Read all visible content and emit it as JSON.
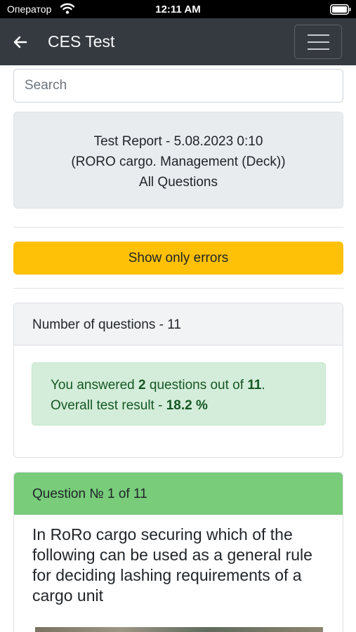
{
  "statusbar": {
    "carrier": "Оператор",
    "time": "12:11 AM"
  },
  "navbar": {
    "title": "CES Test"
  },
  "search": {
    "placeholder": "Search"
  },
  "report": {
    "line1": "Test Report - 5.08.2023 0:10",
    "line2": "(RORO cargo. Management (Deck))",
    "line3": "All Questions"
  },
  "errors_button": {
    "label": "Show only errors"
  },
  "summary": {
    "header": "Number of questions - 11",
    "answered_prefix": "You answered ",
    "answered_count": "2",
    "answered_middle": " questions out of ",
    "total": "11",
    "answered_suffix": ".",
    "result_prefix": "Overall test result - ",
    "result_value": "18.2 %"
  },
  "question": {
    "header": "Question № 1 of 11",
    "text": "In RoRo cargo securing which of the following can be used as a general rule for deciding lashing requirements of a cargo unit"
  },
  "colors": {
    "navbar": "#343a40",
    "warning": "#ffc107",
    "success_bg": "#d4edda",
    "success_text": "#155724",
    "question_header": "#78cc7a"
  }
}
